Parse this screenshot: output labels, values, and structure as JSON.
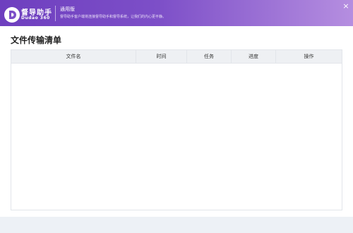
{
  "app": {
    "name": "督导助手",
    "sub_name": "Dudao 360",
    "edition": "通用版",
    "tagline": "督导助手客户端将连接督导助手和督导系统，让我们的内心更平静。",
    "close_label": "×"
  },
  "page": {
    "title": "文件传输清单"
  },
  "table": {
    "columns": [
      "文件名",
      "时间",
      "任务",
      "进度",
      "操作"
    ],
    "rows": []
  },
  "colors": {
    "header_start": "#6e3fbf",
    "header_end": "#b58ee0",
    "table_header_bg": "#eef0f3",
    "page_bg": "#edf1f6"
  }
}
